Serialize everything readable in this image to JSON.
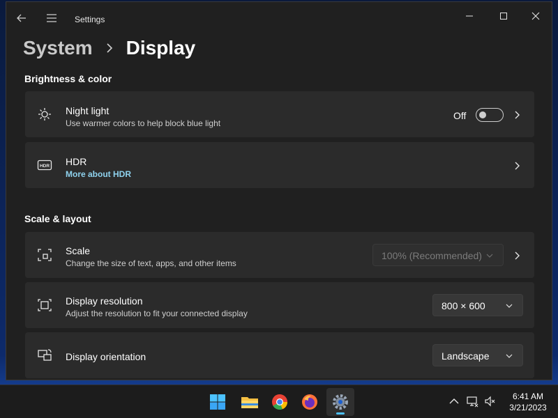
{
  "window": {
    "title": "Settings"
  },
  "breadcrumb": {
    "parent": "System",
    "current": "Display"
  },
  "sections": {
    "brightness": "Brightness & color",
    "scale": "Scale & layout"
  },
  "cards": {
    "night_light": {
      "title": "Night light",
      "subtitle": "Use warmer colors to help block blue light",
      "toggle_label": "Off",
      "toggle_on": false
    },
    "hdr": {
      "title": "HDR",
      "link": "More about HDR"
    },
    "scale": {
      "title": "Scale",
      "subtitle": "Change the size of text, apps, and other items",
      "value": "100% (Recommended)",
      "disabled": true
    },
    "resolution": {
      "title": "Display resolution",
      "subtitle": "Adjust the resolution to fit your connected display",
      "value": "800 × 600"
    },
    "orientation": {
      "title": "Display orientation",
      "value": "Landscape"
    }
  },
  "taskbar": {
    "apps": [
      "start-icon",
      "file-explorer-icon",
      "chrome-icon",
      "firefox-icon",
      "settings-icon"
    ],
    "active_app": "settings-icon",
    "time": "6:41 AM",
    "date": "3/21/2023"
  },
  "colors": {
    "window_bg": "#202020",
    "card_bg": "#2b2b2b",
    "link": "#8fd2ee",
    "accent": "#4cc2ff"
  }
}
